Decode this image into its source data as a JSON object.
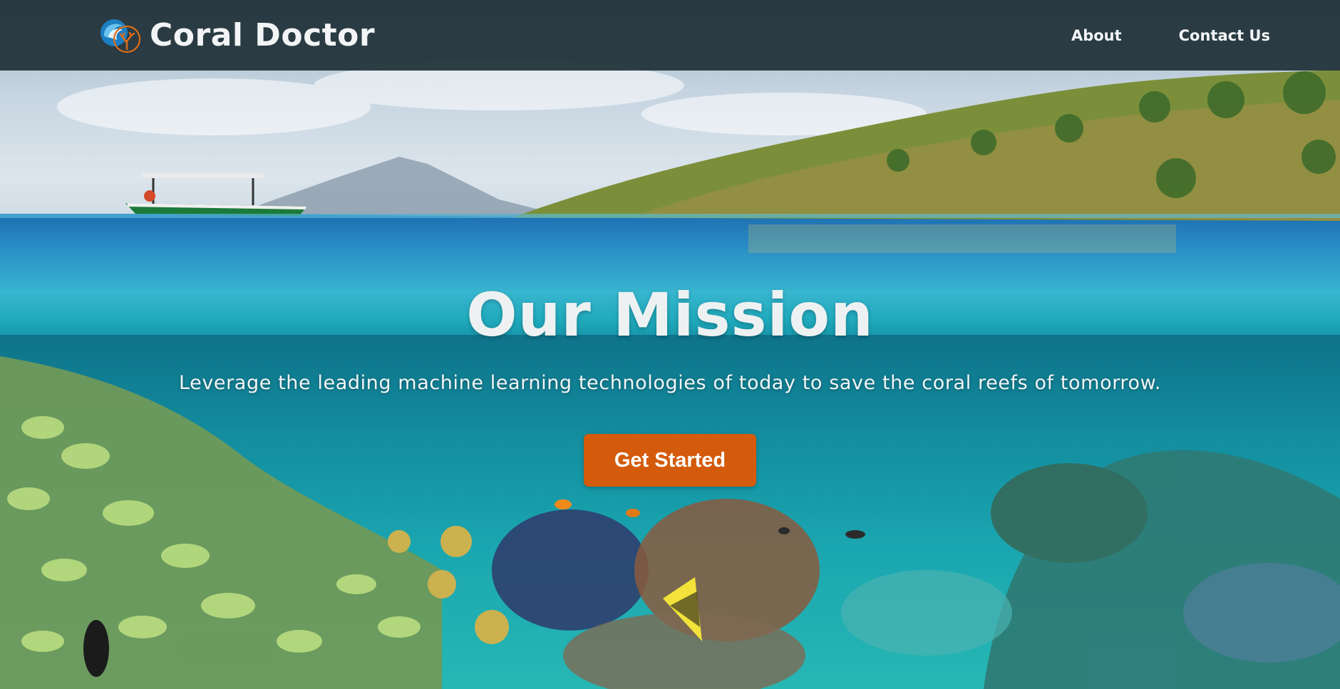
{
  "navbar": {
    "brand_name": "Coral Doctor",
    "logo_icon": "coral-wave-logo-icon",
    "links": [
      {
        "label": "About"
      },
      {
        "label": "Contact Us"
      }
    ]
  },
  "hero": {
    "title": "Our Mission",
    "subtitle": "Leverage the leading machine learning technologies of today to save the coral reefs of tomorrow.",
    "cta_label": "Get Started",
    "background_image": "underwater-coral-reef-split-view"
  },
  "colors": {
    "navbar_bg": "#203038",
    "cta": "#d35b0b",
    "text_light": "#f2f4f5"
  }
}
